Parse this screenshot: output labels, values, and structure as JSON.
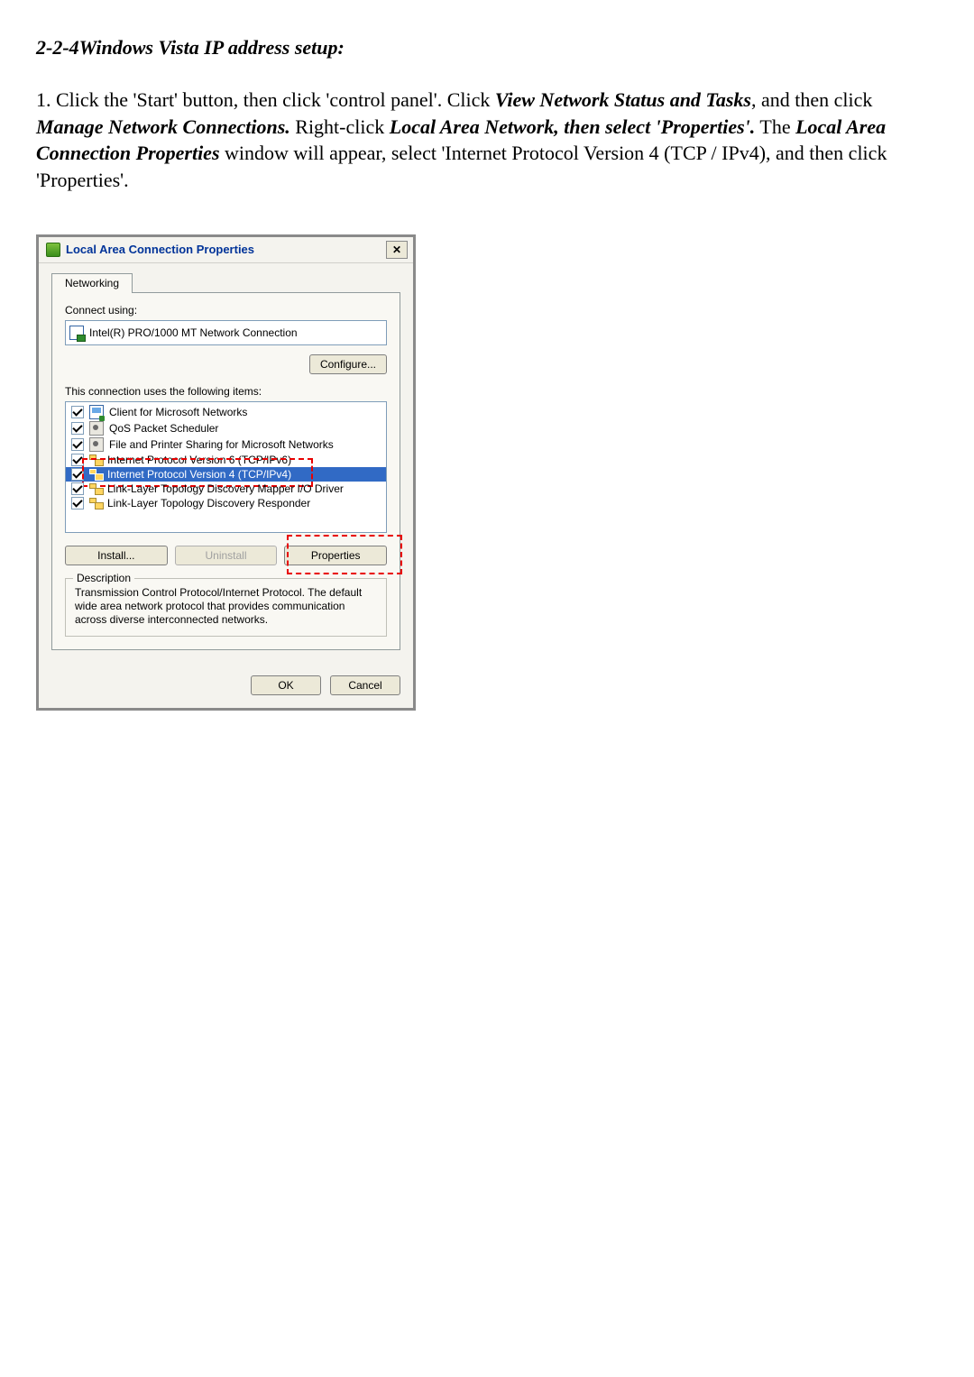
{
  "heading": "2-2-4Windows Vista IP address setup:",
  "instructions": {
    "p1_a": "1. Click the 'Start' button, then click 'control panel'. Click ",
    "p1_b": "View Network Status and Tasks",
    "p1_c": ", and then click ",
    "p1_d": "Manage Network Connections.",
    "p1_e": " Right-click ",
    "p1_f": "Local Area Network, then select 'Properties'.",
    "p1_g": " The ",
    "p1_h": "Local Area Connection Properties",
    "p1_i": " window will appear, select 'Internet Protocol Version 4 (TCP / IPv4), and then click 'Properties'."
  },
  "dialog": {
    "title": "Local Area Connection Properties",
    "tab": "Networking",
    "connect_label": "Connect using:",
    "adapter": "Intel(R) PRO/1000 MT Network Connection",
    "configure": "Configure...",
    "uses_label": "This connection uses the following items:",
    "items": [
      "Client for Microsoft Networks",
      "QoS Packet Scheduler",
      "File and Printer Sharing for Microsoft Networks",
      "Internet Protocol Version 6 (TCP/IPv6)",
      "Internet Protocol Version 4 (TCP/IPv4)",
      "Link-Layer Topology Discovery Mapper I/O Driver",
      "Link-Layer Topology Discovery Responder"
    ],
    "install": "Install...",
    "uninstall": "Uninstall",
    "properties": "Properties",
    "desc_legend": "Description",
    "desc_text": "Transmission Control Protocol/Internet Protocol. The default wide area network protocol that provides communication across diverse interconnected networks.",
    "ok": "OK",
    "cancel": "Cancel"
  }
}
